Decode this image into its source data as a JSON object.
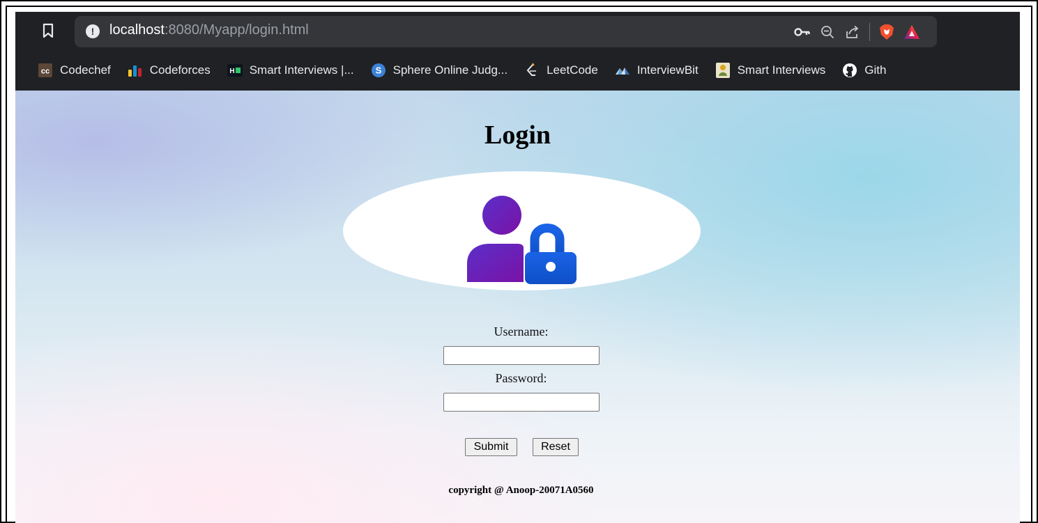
{
  "browser": {
    "url_host": "localhost",
    "url_rest": ":8080/Myapp/login.html",
    "toolbar_icons": [
      "key-icon",
      "zoom-out-icon",
      "share-icon",
      "brave-shields-icon",
      "brave-rewards-icon"
    ]
  },
  "bookmarks": [
    {
      "label": "Codechef",
      "icon": "codechef-icon"
    },
    {
      "label": "Codeforces",
      "icon": "codeforces-icon"
    },
    {
      "label": "Smart Interviews |...",
      "icon": "hackerrank-icon"
    },
    {
      "label": "Sphere Online Judg...",
      "icon": "spoj-icon"
    },
    {
      "label": "LeetCode",
      "icon": "leetcode-icon"
    },
    {
      "label": "InterviewBit",
      "icon": "interviewbit-icon"
    },
    {
      "label": "Smart Interviews",
      "icon": "smart-interviews-icon"
    },
    {
      "label": "Gith",
      "icon": "github-icon"
    }
  ],
  "page": {
    "title": "Login",
    "username_label": "Username:",
    "username_value": "",
    "password_label": "Password:",
    "password_value": "",
    "submit_label": "Submit",
    "reset_label": "Reset",
    "copyright": "copyright @ Anoop-20071A0560"
  },
  "colors": {
    "chrome_bg": "#202124",
    "omnibox_bg": "#35363a",
    "user_icon_purple": "#6a1fb8",
    "lock_icon_blue": "#1759d8"
  }
}
